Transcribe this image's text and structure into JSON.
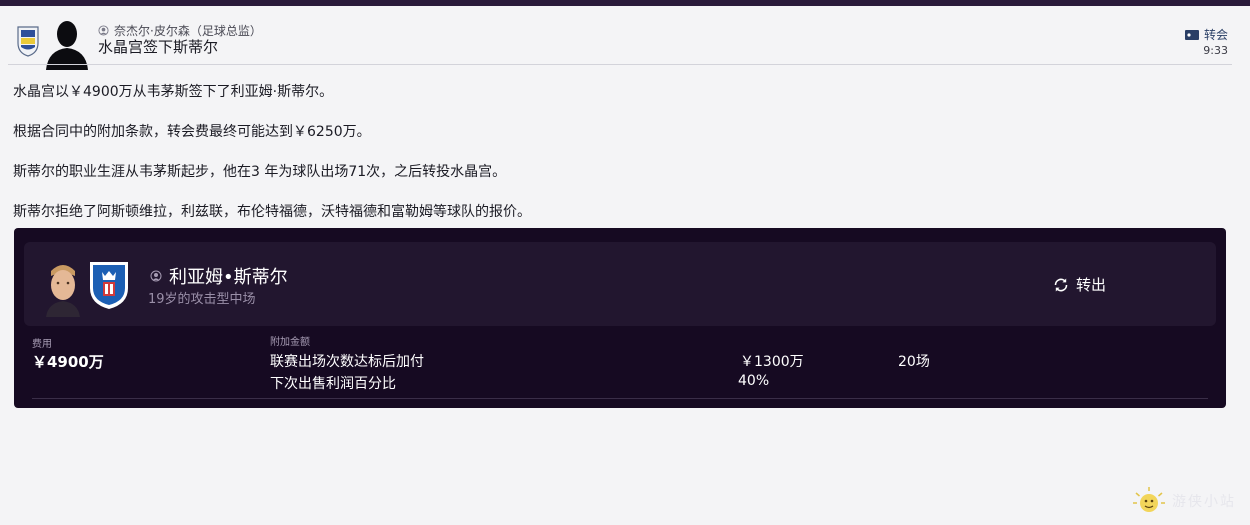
{
  "header": {
    "sender": "奈杰尔·皮尔森（足球总监）",
    "headline": "水晶宫签下斯蒂尔",
    "type": "转会",
    "time": "9:33"
  },
  "body": {
    "paragraphs": [
      "水晶宫以￥4900万从韦茅斯签下了利亚姆·斯蒂尔。",
      "根据合同中的附加条款，转会费最终可能达到￥6250万。",
      "斯蒂尔的职业生涯从韦茅斯起步，他在3 年为球队出场71次，之后转投水晶宫。",
      "斯蒂尔拒绝了阿斯顿维拉，利兹联，布伦特福德，沃特福德和富勒姆等球队的报价。"
    ]
  },
  "card": {
    "player_name": "利亚姆•斯蒂尔",
    "player_desc": "19岁的攻击型中场",
    "transfer_status": "转出",
    "fee_label": "费用",
    "fee_value": "￥4900万",
    "addons_label": "附加金额",
    "addons": [
      {
        "condition": "联赛出场次数达标后加付",
        "amount": "￥1300万",
        "threshold": "20场"
      },
      {
        "condition": "下次出售利润百分比",
        "amount": "40%",
        "threshold": ""
      }
    ]
  },
  "watermark": {
    "text": "游侠小站"
  },
  "colors": {
    "card_bg": "#160a22",
    "card_inner_bg": "#22162f",
    "page_bg": "#f4f4f6",
    "tag_blue": "#2a3f66"
  },
  "icons": {
    "club_badge": "club-crest-icon",
    "sender_avatar": "silhouette-icon",
    "sender_role": "person-icon",
    "news_type": "tag-icon",
    "transfer": "refresh-icon"
  }
}
